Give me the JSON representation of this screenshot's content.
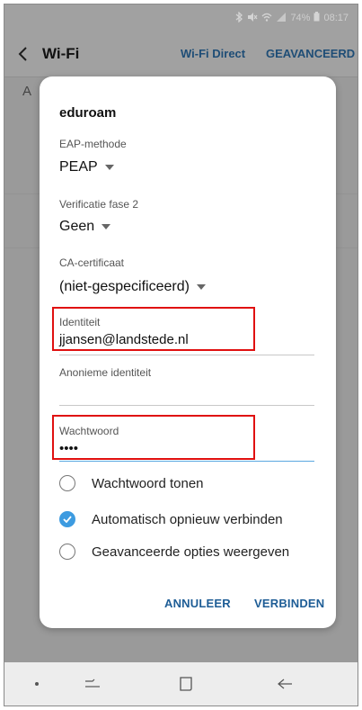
{
  "status_bar": {
    "icons": [
      "bluetooth-icon",
      "mute-icon",
      "signal-icon",
      "wifi-icon"
    ],
    "battery": "74%",
    "time": "08:17"
  },
  "app_bar": {
    "title": "Wi-Fi",
    "wifi_direct": "Wi-Fi Direct",
    "advanced": "GEAVANCEERD"
  },
  "underlay": {
    "partial_letter": "A"
  },
  "dialog": {
    "network_name": "eduroam",
    "eap_method": {
      "label": "EAP-methode",
      "value": "PEAP"
    },
    "phase2": {
      "label": "Verificatie fase 2",
      "value": "Geen"
    },
    "ca_cert": {
      "label": "CA-certificaat",
      "value": "(niet-gespecificeerd)"
    },
    "identity": {
      "label": "Identiteit",
      "value": "jjansen@landstede.nl"
    },
    "anonymous_identity": {
      "label": "Anonieme identiteit",
      "value": ""
    },
    "password": {
      "label": "Wachtwoord",
      "value": "••••"
    },
    "options": [
      {
        "label": "Wachtwoord tonen",
        "checked": false
      },
      {
        "label": "Automatisch opnieuw verbinden",
        "checked": true
      },
      {
        "label": "Geavanceerde opties weergeven",
        "checked": false
      }
    ],
    "cancel_label": "ANNULEER",
    "connect_label": "VERBINDEN"
  },
  "nav_bar": {
    "icons": [
      "dot-icon",
      "recent-apps-icon",
      "home-icon",
      "back-icon"
    ]
  },
  "colors": {
    "accent": "#3d9be0",
    "button_text": "#1e5d96",
    "highlight": "#e01010"
  }
}
